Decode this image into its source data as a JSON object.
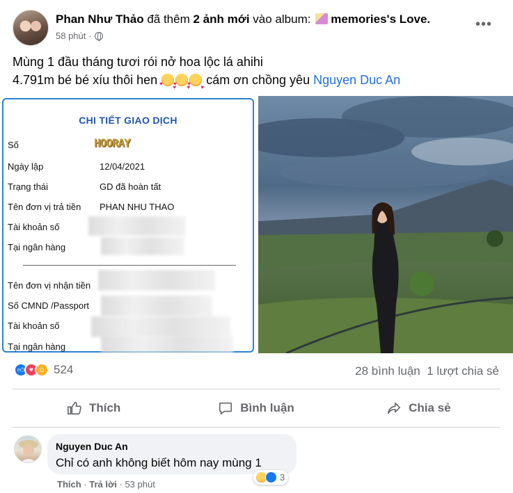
{
  "post": {
    "author": "Phan Như Thảo",
    "action_text": "đã thêm",
    "action_count": "2 ảnh mới",
    "album_prefix": "vào album:",
    "album_name": "memories's Love.",
    "time": "58 phút",
    "separator": "·",
    "more_label": "•••",
    "caption_line1": "Mùng 1 đầu tháng tươi rói nở hoa lộc lá ahihi",
    "caption_line2_prefix": "4.791m bé bé xíu thôi hen",
    "caption_line2_suffix": "cám ơn chồng yêu",
    "caption_mention": "Nguyen Duc An",
    "caption_emoji": "smiling-face-with-hearts-icon"
  },
  "receipt": {
    "title": "CHI TIẾT GIAO DỊCH",
    "rows": [
      {
        "label": "Số",
        "value": "HOORAY"
      },
      {
        "label": "Ngày lập",
        "value": "12/04/2021"
      },
      {
        "label": "Trạng thái",
        "value": "GD đã hoàn tất"
      },
      {
        "label": "Tên đơn vị trả tiền",
        "value": "PHAN NHU THAO"
      },
      {
        "label": "Tài khoản số",
        "value": ""
      },
      {
        "label": "Tại ngân hàng",
        "value": ""
      },
      {
        "label": "Tên đơn vị nhận tiền",
        "value": ""
      },
      {
        "label": "Số CMND /Passport",
        "value": ""
      },
      {
        "label": "Tài khoản số",
        "value": ""
      },
      {
        "label": "Tại ngân hàng",
        "value": ""
      }
    ]
  },
  "reactions": {
    "count": "524",
    "types": [
      "like",
      "love",
      "care"
    ],
    "comments": "28 bình luận",
    "shares": "1 lượt chia sẻ"
  },
  "actions": {
    "like": "Thích",
    "comment": "Bình luận",
    "share": "Chia sẻ"
  },
  "comment": {
    "author": "Nguyen Duc An",
    "text": "Chỉ có anh không biết hôm nay mùng 1",
    "reaction_count": "3",
    "like_label": "Thích",
    "reply_label": "Trả lời",
    "separator": "·",
    "time": "53 phút"
  },
  "colors": {
    "accent": "#1877f2",
    "mention": "#216fdb",
    "muted": "#65676b",
    "receipt_border": "#2d7fd0"
  }
}
